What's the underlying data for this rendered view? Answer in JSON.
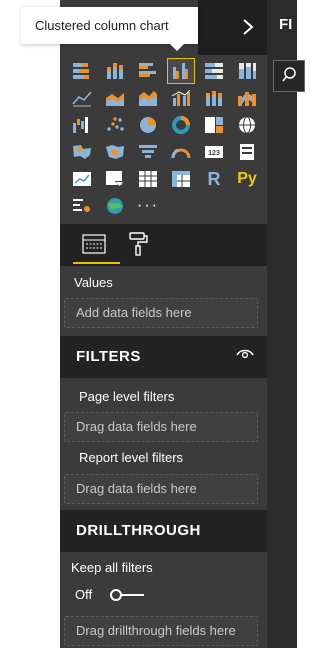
{
  "tooltip": {
    "text": "Clustered column chart"
  },
  "topbar": {
    "pane_label": "FI"
  },
  "visualizations": {
    "rows": [
      [
        "stacked-bar-icon",
        "stacked-column-icon",
        "clustered-bar-icon",
        "clustered-column-icon",
        "100-stacked-bar-icon",
        "100-stacked-column-icon"
      ],
      [
        "line-chart-icon",
        "area-chart-icon",
        "stacked-area-icon",
        "line-clustered-column-icon",
        "line-stacked-column-icon",
        "ribbon-chart-icon"
      ],
      [
        "waterfall-icon",
        "scatter-icon",
        "pie-icon",
        "donut-icon",
        "treemap-icon",
        "map-icon"
      ],
      [
        "filled-map-icon",
        "shape-map-icon",
        "funnel-icon",
        "gauge-icon",
        "card-icon",
        "multi-row-card-icon"
      ],
      [
        "kpi-icon",
        "slicer-icon",
        "table-icon",
        "matrix-icon",
        "r-visual-icon",
        "python-visual-icon"
      ],
      [
        "key-influencers-icon",
        "arcgis-map-icon",
        "more-visuals-icon"
      ]
    ],
    "r_label": "R",
    "py_label": "Py",
    "more_label": "···",
    "selected": "clustered-column-icon"
  },
  "fields": {
    "values_label": "Values",
    "values_placeholder": "Add data fields here"
  },
  "filters": {
    "title": "FILTERS",
    "page_level_label": "Page level filters",
    "page_level_placeholder": "Drag data fields here",
    "report_level_label": "Report level filters",
    "report_level_placeholder": "Drag data fields here"
  },
  "drillthrough": {
    "title": "DRILLTHROUGH",
    "keep_all_label": "Keep all filters",
    "toggle_state": "Off",
    "placeholder": "Drag drillthrough fields here"
  },
  "colors": {
    "accent": "#e6c200",
    "panel": "#3b3b3b",
    "band": "#232323",
    "viz_blue": "#8ab4d9",
    "viz_orange": "#e8912d",
    "viz_teal": "#2d9cb4"
  }
}
